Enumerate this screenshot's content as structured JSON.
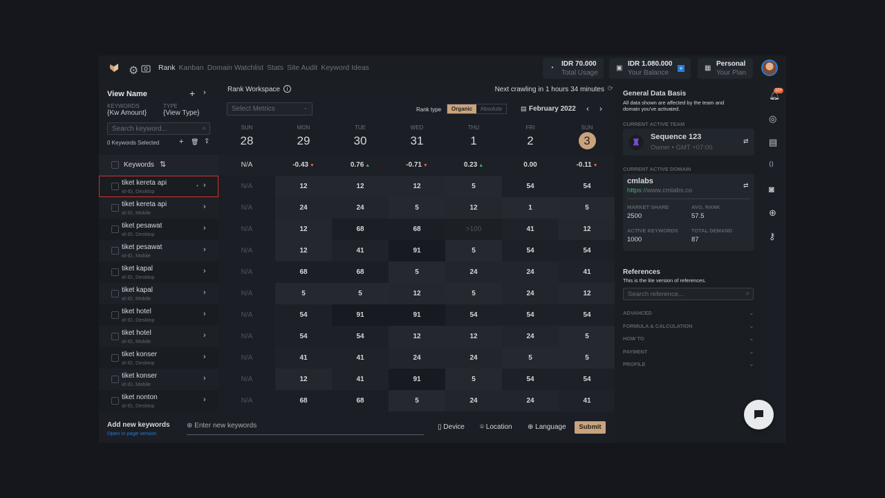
{
  "nav": {
    "items": [
      "Rank",
      "Kanban",
      "Domain Watchlist",
      "Stats",
      "Site Audit",
      "Keyword Ideas"
    ],
    "active": "Rank"
  },
  "header": {
    "usage": {
      "value": "IDR 70.000",
      "label": "Total Usage",
      "icon": "pie-chart-icon"
    },
    "balance": {
      "value": "IDR 1.080.000",
      "label": "Your Balance",
      "icon": "wallet-icon"
    },
    "plan": {
      "value": "Personal",
      "label": "Your Plan",
      "icon": "grid-icon"
    }
  },
  "left": {
    "title": "View Name",
    "kw_label": "KEYWORDS",
    "kw_value": "{Kw Amount}",
    "type_label": "TYPE",
    "type_value": "{View Type}",
    "search_placeholder": "Search keyword...",
    "selected": "0 Keywords Selected",
    "keywords_header": "Keywords"
  },
  "workspace": {
    "title": "Rank Workspace",
    "crawl": "Next crawling in 1 hours 34 minutes",
    "metrics_placeholder": "Select Metrics",
    "rank_type_label": "Rank type",
    "rank_types": [
      "Organic",
      "Absolute"
    ],
    "rank_type_active": "Organic",
    "month": "February 2022"
  },
  "days": [
    {
      "dow": "SUN",
      "num": "28",
      "change": "N/A",
      "dir": ""
    },
    {
      "dow": "MON",
      "num": "29",
      "change": "-0.43",
      "dir": "down"
    },
    {
      "dow": "TUE",
      "num": "30",
      "change": "0.76",
      "dir": "up"
    },
    {
      "dow": "WED",
      "num": "31",
      "change": "-0.71",
      "dir": "down"
    },
    {
      "dow": "THU",
      "num": "1",
      "change": "0.23",
      "dir": "up"
    },
    {
      "dow": "FRI",
      "num": "2",
      "change": "0.00",
      "dir": ""
    },
    {
      "dow": "SUN",
      "num": "3",
      "change": "-0.11",
      "dir": "down",
      "today": true
    }
  ],
  "rows": [
    {
      "name": "tiket kereta api",
      "meta": "id-ID, Desktop",
      "values": [
        "N/A",
        "12",
        "12",
        "12",
        "5",
        "54",
        "54"
      ],
      "selected": true
    },
    {
      "name": "tiket kereta api",
      "meta": "id-ID, Mobile",
      "values": [
        "N/A",
        "24",
        "24",
        "5",
        "12",
        "1",
        "5"
      ]
    },
    {
      "name": "tiket pesawat",
      "meta": "id-ID, Desktop",
      "values": [
        "N/A",
        "12",
        "68",
        "68",
        ">100",
        "41",
        "12"
      ]
    },
    {
      "name": "tiket pesawat",
      "meta": "id-ID, Mobile",
      "values": [
        "N/A",
        "12",
        "41",
        "91",
        "5",
        "54",
        "54"
      ]
    },
    {
      "name": "tiket kapal",
      "meta": "id-ID, Desktop",
      "values": [
        "N/A",
        "68",
        "68",
        "5",
        "24",
        "24",
        "41"
      ]
    },
    {
      "name": "tiket kapal",
      "meta": "id-ID, Mobile",
      "values": [
        "N/A",
        "5",
        "5",
        "12",
        "5",
        "24",
        "12"
      ]
    },
    {
      "name": "tiket hotel",
      "meta": "id-ID, Desktop",
      "values": [
        "N/A",
        "54",
        "91",
        "91",
        "54",
        "54",
        "54"
      ]
    },
    {
      "name": "tiket hotel",
      "meta": "id-ID, Mobile",
      "values": [
        "N/A",
        "54",
        "54",
        "12",
        "12",
        "24",
        "5"
      ]
    },
    {
      "name": "tiket konser",
      "meta": "id-ID, Desktop",
      "values": [
        "N/A",
        "41",
        "41",
        "24",
        "24",
        "5",
        "5"
      ]
    },
    {
      "name": "tiket konser",
      "meta": "id-ID, Mobile",
      "values": [
        "N/A",
        "12",
        "41",
        "91",
        "5",
        "54",
        "54"
      ]
    },
    {
      "name": "tiket nonton",
      "meta": "id-ID, Desktop",
      "values": [
        "N/A",
        "68",
        "68",
        "5",
        "24",
        "24",
        "41"
      ]
    }
  ],
  "footer": {
    "title": "Add new keywords",
    "link": "Open in page version",
    "input_placeholder": "Enter new keywords",
    "device": "Device",
    "location": "Location",
    "language": "Language",
    "submit": "Submit"
  },
  "right": {
    "title": "General Data Basis",
    "desc1": "All data shown are affected by the team and",
    "desc2": "domain you've activated.",
    "team_label": "CURRENT ACTIVE TEAM",
    "team_name": "Sequence 123",
    "team_meta": "Owner • GMT +07:00",
    "domain_label": "CURRENT ACTIVE DOMAIN",
    "domain_name": "cmlabs",
    "domain_scheme": "https",
    "domain_rest": "://www.cmlabs.co",
    "stats": [
      {
        "label": "MARKET SHARE",
        "value": "2500"
      },
      {
        "label": "AVG. RANK",
        "value": "57.5"
      },
      {
        "label": "ACTIVE KEYWORDS",
        "value": "1000"
      },
      {
        "label": "TOTAL DEMAND",
        "value": "87"
      }
    ],
    "ref_title": "References",
    "ref_desc": "This is the lite version of references.",
    "ref_placeholder": "Search reference...",
    "accordions": [
      "ADVANCED",
      "FORMULA & CALCULATION",
      "HOW TO",
      "PAYMENT",
      "PROFILE"
    ]
  },
  "rail": {
    "badge": "10+",
    "icons": [
      "bell-icon",
      "target-icon",
      "calendar-icon",
      "code-icon",
      "camera-icon",
      "globe-icon",
      "key-icon"
    ]
  },
  "colors": {
    "accent": "#c9a37e",
    "up": "#3fb56a",
    "down": "#e0693a",
    "link": "#2a7ad8",
    "selected_outline": "#d0312d"
  }
}
